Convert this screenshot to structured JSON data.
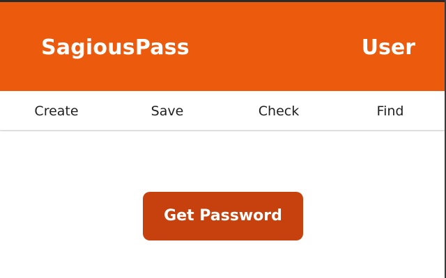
{
  "header": {
    "brand": "SagiousPass",
    "user": "User"
  },
  "nav": {
    "items": [
      {
        "label": "Create"
      },
      {
        "label": "Save"
      },
      {
        "label": "Check"
      },
      {
        "label": "Find"
      }
    ]
  },
  "main": {
    "get_password_label": "Get Password"
  },
  "colors": {
    "header_bg": "#eb5a0d",
    "button_bg": "#c6410d",
    "text_light": "#ffffff",
    "nav_text": "#1f1f1f"
  }
}
